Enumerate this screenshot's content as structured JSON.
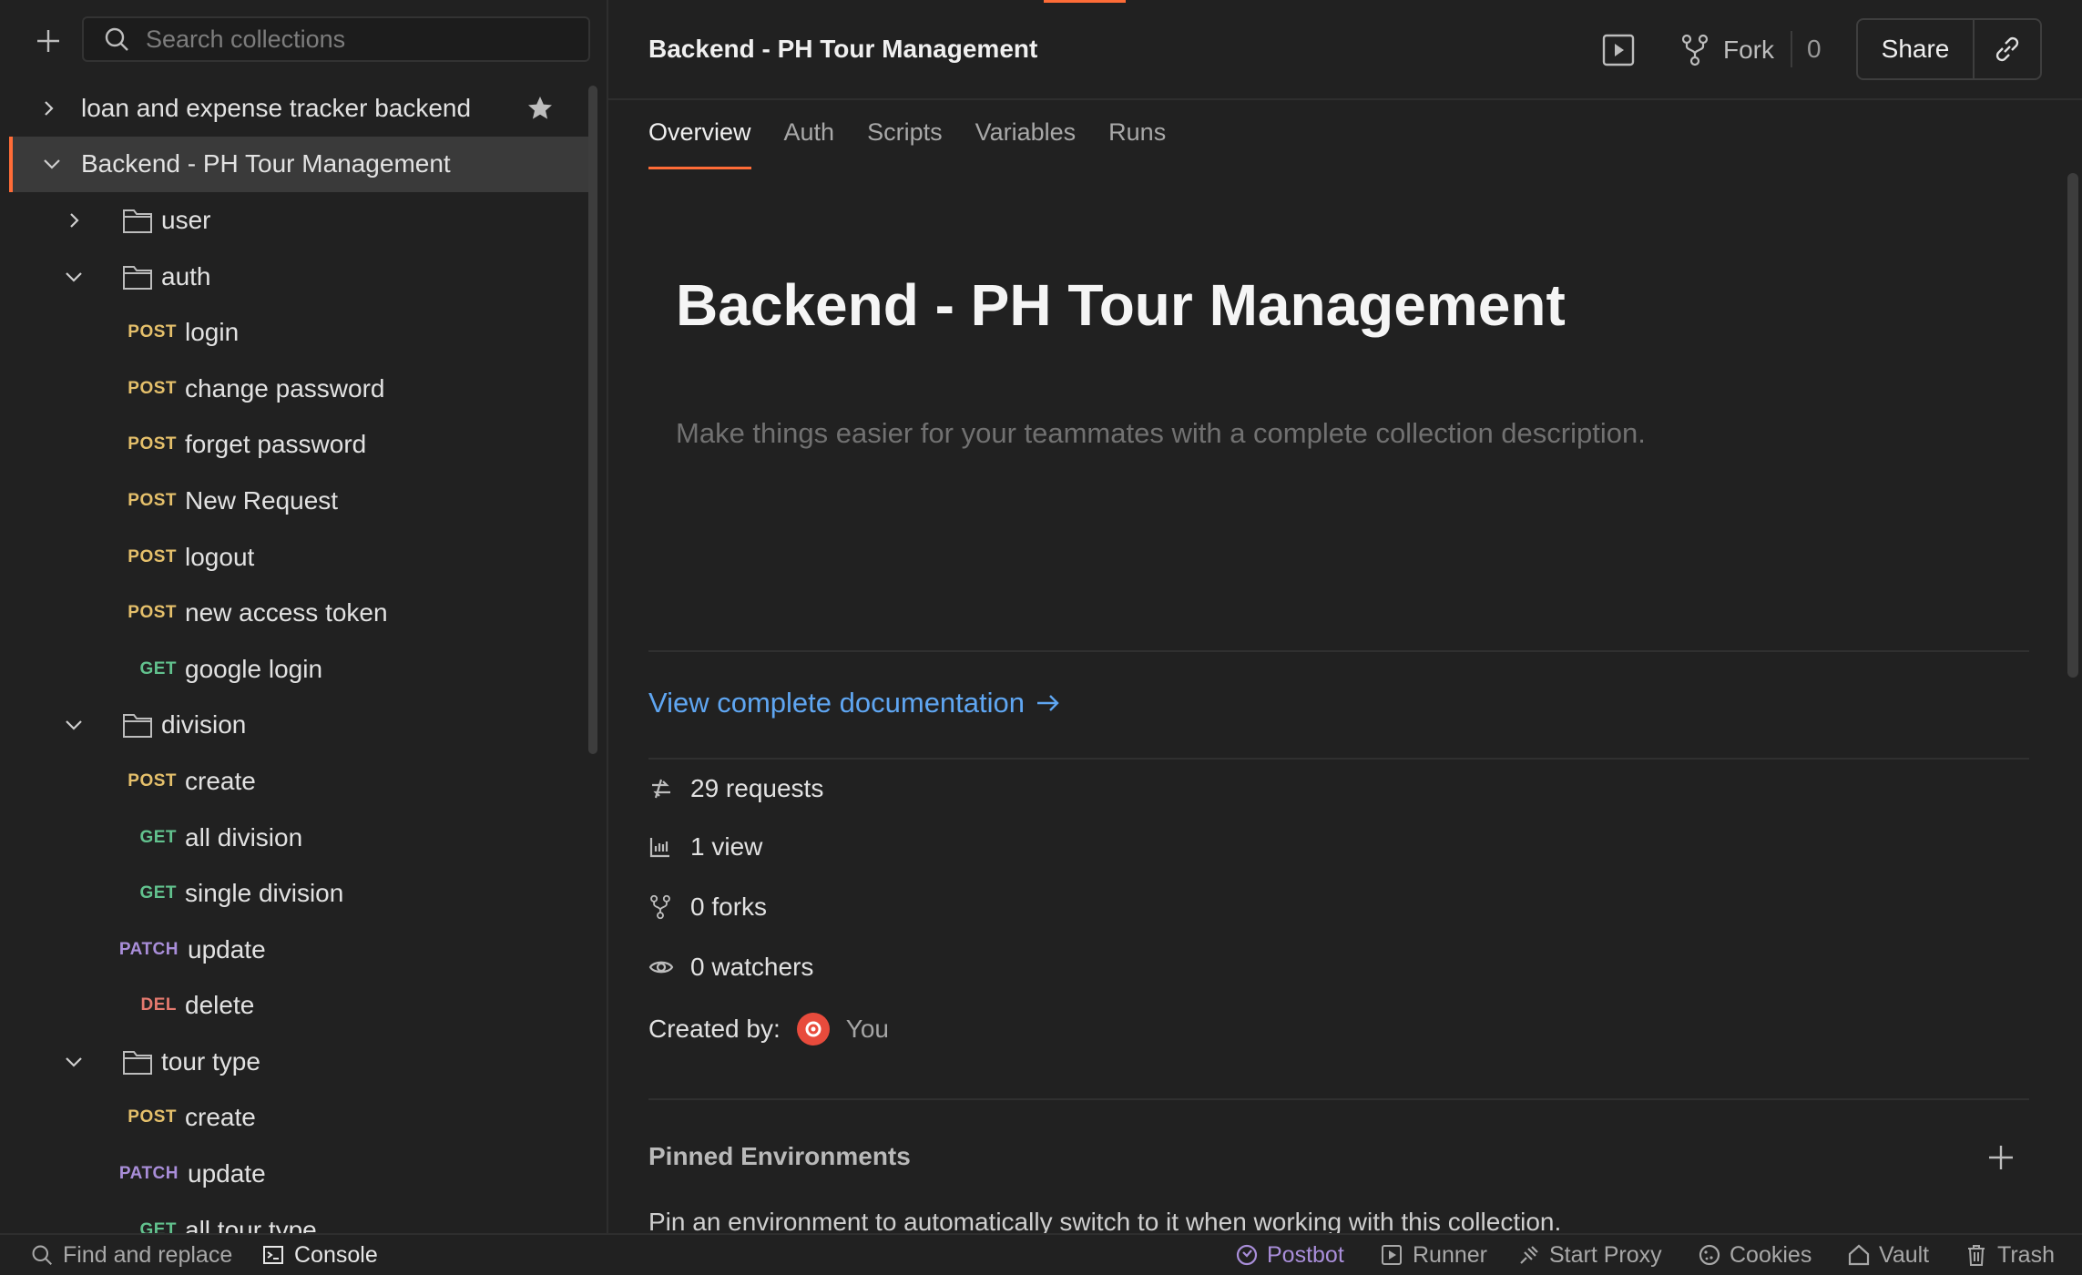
{
  "sidebar": {
    "search_placeholder": "Search collections",
    "collections": [
      {
        "label": "loan and expense tracker backend",
        "expanded": false,
        "starred": true
      },
      {
        "label": "Backend - PH Tour Management",
        "expanded": true,
        "selected": true
      }
    ],
    "items": [
      {
        "type": "folder",
        "label": "user",
        "expanded": false
      },
      {
        "type": "folder",
        "label": "auth",
        "expanded": true
      },
      {
        "type": "request",
        "method": "POST",
        "label": "login"
      },
      {
        "type": "request",
        "method": "POST",
        "label": "change password"
      },
      {
        "type": "request",
        "method": "POST",
        "label": "forget password"
      },
      {
        "type": "request",
        "method": "POST",
        "label": "New Request"
      },
      {
        "type": "request",
        "method": "POST",
        "label": "logout"
      },
      {
        "type": "request",
        "method": "POST",
        "label": "new access token"
      },
      {
        "type": "request",
        "method": "GET",
        "label": "google login"
      },
      {
        "type": "folder",
        "label": "division",
        "expanded": true
      },
      {
        "type": "request",
        "method": "POST",
        "label": "create"
      },
      {
        "type": "request",
        "method": "GET",
        "label": "all division"
      },
      {
        "type": "request",
        "method": "GET",
        "label": "single division"
      },
      {
        "type": "request",
        "method": "PATCH",
        "label": "update"
      },
      {
        "type": "request",
        "method": "DEL",
        "label": "delete"
      },
      {
        "type": "folder",
        "label": "tour type",
        "expanded": true
      },
      {
        "type": "request",
        "method": "POST",
        "label": "create"
      },
      {
        "type": "request",
        "method": "PATCH",
        "label": "update"
      },
      {
        "type": "request",
        "method": "GET",
        "label": "all tour type"
      }
    ]
  },
  "header": {
    "title": "Backend - PH Tour Management",
    "fork_label": "Fork",
    "fork_count": "0",
    "share_label": "Share"
  },
  "tabs": [
    "Overview",
    "Auth",
    "Scripts",
    "Variables",
    "Runs"
  ],
  "active_tab": "Overview",
  "overview": {
    "title": "Backend - PH Tour Management",
    "description_placeholder": "Make things easier for your teammates with a complete collection description.",
    "doc_link": "View complete documentation",
    "stats": {
      "requests": "29 requests",
      "views": "1 view",
      "forks": "0 forks",
      "watchers": "0 watchers"
    },
    "created_by_label": "Created by:",
    "created_by_user": "You",
    "pinned_title": "Pinned Environments",
    "pinned_desc": "Pin an environment to automatically switch to it when working with this collection."
  },
  "statusbar": {
    "find_replace": "Find and replace",
    "console": "Console",
    "postbot": "Postbot",
    "runner": "Runner",
    "start_proxy": "Start Proxy",
    "cookies": "Cookies",
    "vault": "Vault",
    "trash": "Trash"
  },
  "colors": {
    "accent": "#ff6c37",
    "post": "#e5c06b",
    "get": "#62c28e",
    "patch": "#a98ed9",
    "delete": "#e57a6f",
    "link": "#5fa6f2"
  }
}
